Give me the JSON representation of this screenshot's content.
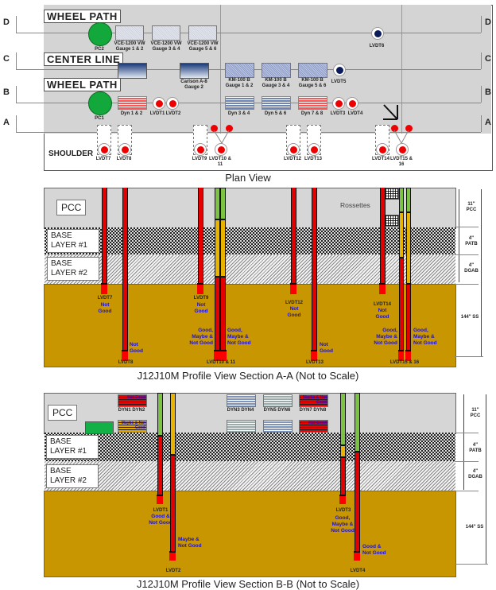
{
  "plan_view": {
    "title": "Plan View",
    "lanes": {
      "wheel_path_top": "WHEEL PATH",
      "center_line": "CENTER LINE",
      "wheel_path_bottom": "WHEEL PATH",
      "shoulder": "SHOULDER"
    },
    "section_markers": [
      "D",
      "C",
      "B",
      "A"
    ],
    "pressure_cells": [
      "PC2",
      "PC1"
    ],
    "vw_gauges": [
      "VCE-1200 VW Gauge 1 & 2",
      "VCE-1200 VW Gauge 3 & 4",
      "VCE-1200 VW Gauge 5 & 6"
    ],
    "carlson": "Carlson A-8 Gauge 2",
    "km_gauges": [
      "KM-100 B Gauge 1 & 2",
      "KM-100 B Gauge 3 & 4",
      "KM-100 B Gauge 5 & 6"
    ],
    "dyn_labels": [
      "Dyn 1 & 2",
      "Dyn 3 & 4",
      "Dyn 5 & 6",
      "Dyn 7 & 8"
    ],
    "lvdt_labels": {
      "lvdt1": "LVDT1",
      "lvdt2": "LVDT2",
      "lvdt3": "LVDT3",
      "lvdt4": "LVDT4",
      "lvdt5": "LVDT5",
      "lvdt6": "LVDT6",
      "lvdt7": "LVDT7",
      "lvdt8": "LVDT8",
      "lvdt9": "LVDT9",
      "lvdt10_11": "LVDT10 & 11",
      "lvdt12": "LVDT12",
      "lvdt13": "LVDT13",
      "lvdt14": "LVDT14",
      "lvdt15_16": "LVDT15 & 16"
    }
  },
  "layers": {
    "pcc": "PCC",
    "base1": "BASE LAYER #1",
    "base2": "BASE LAYER #2",
    "rossettes": "Rossettes",
    "dims": {
      "pcc": "11\" PCC",
      "patb": "4\" PATB",
      "dgab": "4\" DGAB",
      "ss": "144\" SS"
    }
  },
  "section_aa": {
    "title": "J12J10M Profile View Section A-A (Not to Scale)",
    "sensors": [
      {
        "label": "LVDT7",
        "status": "Not Good"
      },
      {
        "label": "LVDT8",
        "status": "Not Good"
      },
      {
        "label": "LVDT9",
        "status": "Not Good"
      },
      {
        "label": "LVDT10 & 11",
        "status_left": "Good, Maybe & Not Good",
        "status_right": "Good, Maybe & Not Good"
      },
      {
        "label": "LVDT12",
        "status": "Not Good"
      },
      {
        "label": "LVDT13",
        "status": "Not Good"
      },
      {
        "label": "LVDT14",
        "status": "Not Good"
      },
      {
        "label": "LVDT15 & 16",
        "status_left": "Good, Maybe & Not Good",
        "status_right": "Good, Maybe & Not Good"
      }
    ]
  },
  "section_bb": {
    "title": "J12J10M Profile View Section B-B (Not to Scale)",
    "dyn_groups": [
      {
        "label": "DYN1 DYN2",
        "top_status": "Not Good",
        "bottom_status": "Maybe & Not Good"
      },
      {
        "label": "DYN3 DYN4"
      },
      {
        "label": "DYN5 DYN6"
      },
      {
        "label": "DYN7 DYN8",
        "top_status": "Maybe & Not Good",
        "bottom_status": "Not Good"
      }
    ],
    "sensors": [
      {
        "label": "LVDT1",
        "status": "Good & Not Good"
      },
      {
        "label": "LVDT2",
        "status": "Maybe & Not Good"
      },
      {
        "label": "LVDT3",
        "status": "Good, Maybe & Not Good"
      },
      {
        "label": "LVDT4",
        "status": "Good & Not Good"
      }
    ]
  }
}
